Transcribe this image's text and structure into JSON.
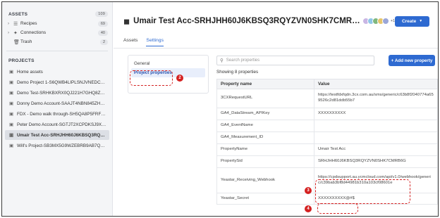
{
  "sidebar": {
    "assets_header": "ASSETS",
    "assets_count": "109",
    "items": [
      {
        "label": "Recipes",
        "count": "69",
        "icon": "recipe-icon",
        "has_chevron": true
      },
      {
        "label": "Connections",
        "count": "40",
        "icon": "plug-icon",
        "has_chevron": true
      },
      {
        "label": "Trash",
        "count": "2",
        "icon": "trash-icon",
        "has_chevron": false
      }
    ],
    "projects_header": "PROJECTS",
    "projects": [
      {
        "label": "Home assets",
        "active": false
      },
      {
        "label": "Demo Project 1-S6QWB4LIPLSNJVNEDCEE…",
        "active": false
      },
      {
        "label": "Demo Test-SRHKBXRX0QJ221H7GHQ8ZC…",
        "active": false
      },
      {
        "label": "Donny Demo Account-SAAJT4NBN845ZH…",
        "active": false
      },
      {
        "label": "FDX - Demo walk through-SH5QA8P5FRF9…",
        "active": false
      },
      {
        "label": "Peter Demo Account-SGTJT2XCPDKSJ9XH…",
        "active": false
      },
      {
        "label": "Umair Test Acc-SRHJHH60J6KBSQ3RQYZ…",
        "active": true
      },
      {
        "label": "Will's Project-SB3MX5G9WZEBRB9AB7Q…",
        "active": false
      }
    ]
  },
  "header": {
    "title": "Umair Test Acc-SRHJHH60J6KBSQ3RQYZVN0SHK7CMR…",
    "avatar_more": "+1",
    "create_label": "Create"
  },
  "tabs": [
    {
      "label": "Assets",
      "active": false
    },
    {
      "label": "Settings",
      "active": true
    }
  ],
  "settings_nav": [
    {
      "label": "General",
      "active": false
    },
    {
      "label": "Project properties",
      "active": true
    }
  ],
  "search": {
    "placeholder": "Search properties"
  },
  "add_button": "+ Add new property",
  "showing_text": "Showing 8 properties",
  "table": {
    "headers": [
      "Property name",
      "Value"
    ],
    "rows": [
      {
        "name": "3CXRequestURL",
        "value": "https://testfdxfqdn.3cx.com.au/sms/generic/c63b8f2040774a659526c2d81ddb55b7"
      },
      {
        "name": "GA4_DataStream_APIKey",
        "value": "XXXXXXXXXX"
      },
      {
        "name": "GA4_EventName",
        "value": ""
      },
      {
        "name": "GA4_Measurement_ID",
        "value": ""
      },
      {
        "name": "PropertyName",
        "value": "Umair Test Acc"
      },
      {
        "name": "PropertySid",
        "value": "SRHJHH60J6KBSQ3RQYZVN0SHK7CMRB6G"
      },
      {
        "name": "Yeastar_Receiving_Webhook",
        "value": "https://cpdsupport.au.ycmcloud.com/api/v1.0/webhook/generic/c39bab3bf8d44981b310a103cf08601e"
      },
      {
        "name": "Yeastar_Secret",
        "value": "XXXXXXXXXX@#$"
      }
    ]
  },
  "annotations": [
    "2",
    "3",
    "4"
  ],
  "colors": {
    "accent": "#2e6ad1",
    "annotation": "#d42020"
  },
  "avatar_colors": [
    "#c9b6e4",
    "#8fc7e8",
    "#7fb77e",
    "#e6c56b",
    "#9aa6d8"
  ]
}
